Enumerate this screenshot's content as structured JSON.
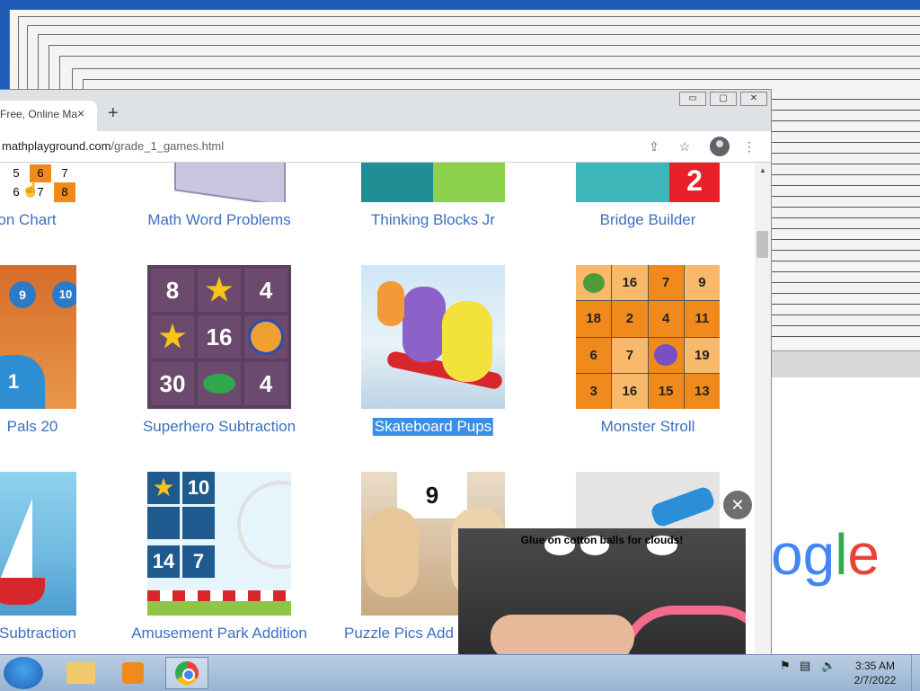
{
  "browser": {
    "tab_title": "Free, Online Ma",
    "close_tab_glyph": "×",
    "new_tab_glyph": "+",
    "window_controls": [
      "▭",
      "▢",
      "✕"
    ],
    "url_host": "mathplayground.com",
    "url_path": "/grade_1_games.html",
    "share_glyph": "⇪",
    "star_glyph": "☆",
    "menu_glyph": "⋮"
  },
  "row1": [
    {
      "label": "on Chart",
      "numbers": [
        "5",
        "6",
        "7",
        "6",
        "7",
        "8"
      ]
    },
    {
      "label": "Math Word Problems"
    },
    {
      "label": "Thinking Blocks Jr"
    },
    {
      "label": "Bridge Builder",
      "number": "2"
    }
  ],
  "row2": [
    {
      "label": "Pals 20",
      "numbers": [
        "9",
        "10",
        "1"
      ]
    },
    {
      "label": "Superhero Subtraction",
      "grid": [
        "8",
        "★",
        "4",
        "★",
        "16",
        "",
        "30",
        "",
        "4"
      ]
    },
    {
      "label": "Skateboard Pups"
    },
    {
      "label": "Monster Stroll",
      "grid": [
        "",
        "16",
        "7",
        "9",
        "18",
        "2",
        "4",
        "11",
        "6",
        "7",
        "",
        "19",
        "3",
        "16",
        "15",
        "13"
      ]
    }
  ],
  "row3": [
    {
      "label": "Subtraction"
    },
    {
      "label": "Amusement Park Addition",
      "grid": [
        "★",
        "10",
        "",
        "",
        "14",
        "7"
      ]
    },
    {
      "label": "Puzzle Pics Add",
      "number": "9"
    },
    {
      "label": ""
    }
  ],
  "video": {
    "caption": "Glue on cotton balls for clouds!",
    "close_glyph": "✕"
  },
  "colors": {
    "link": "#3c6fc1",
    "selected": "#3a8ee6"
  },
  "taskbar": {
    "time": "3:35 AM",
    "date": "2/7/2022",
    "tray_icons": [
      "flag-icon",
      "network-icon",
      "volume-icon"
    ]
  }
}
